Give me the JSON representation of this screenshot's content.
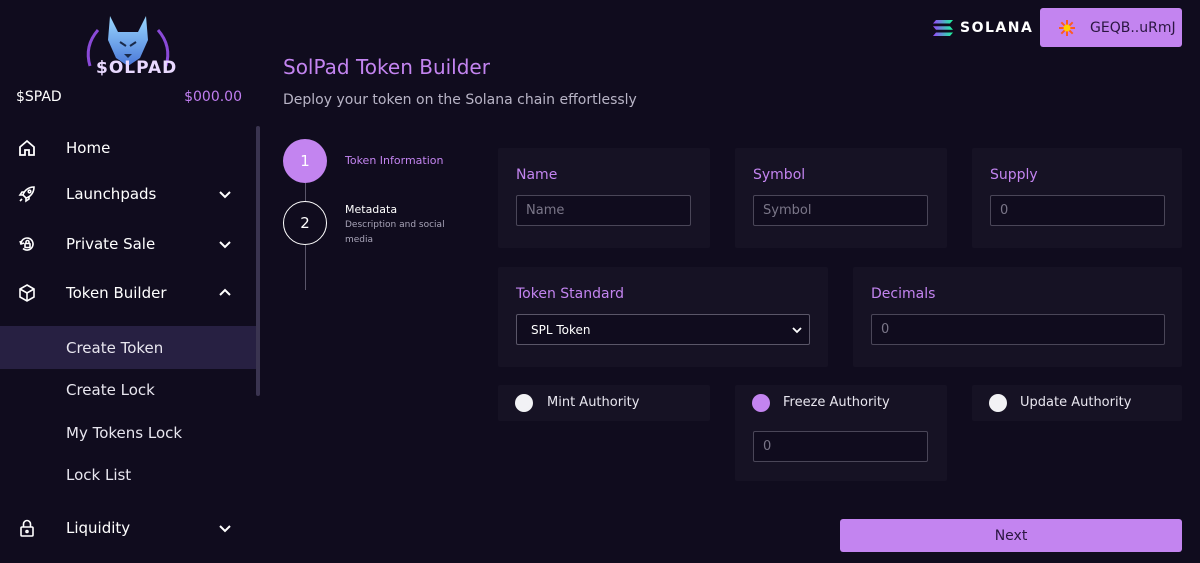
{
  "brand": {
    "logo_text": "$OLPAD"
  },
  "balance": {
    "ticker": "$SPAD",
    "amount": "$000.00"
  },
  "sidebar": {
    "items": [
      {
        "label": "Home",
        "icon": "home-icon"
      },
      {
        "label": "Launchpads",
        "icon": "rocket-icon"
      },
      {
        "label": "Private Sale",
        "icon": "refresh-lock-icon"
      },
      {
        "label": "Token Builder",
        "icon": "cube-icon"
      },
      {
        "label": "Liquidity",
        "icon": "lock-icon"
      }
    ],
    "sub_items": [
      {
        "label": "Create Token",
        "active": true
      },
      {
        "label": "Create Lock",
        "active": false
      },
      {
        "label": "My Tokens Lock",
        "active": false
      },
      {
        "label": "Lock List",
        "active": false
      }
    ]
  },
  "header": {
    "network_label": "SOLANA",
    "wallet_address": "GEQB..uRmJ"
  },
  "page": {
    "title": "SolPad Token Builder",
    "subtitle": "Deploy your token on the Solana chain effortlessly"
  },
  "stepper": {
    "steps": [
      {
        "number": "1",
        "title": "Token Information",
        "description": ""
      },
      {
        "number": "2",
        "title": "Metadata",
        "description": "Description and social media"
      }
    ]
  },
  "form": {
    "name": {
      "label": "Name",
      "placeholder": "Name"
    },
    "symbol": {
      "label": "Symbol",
      "placeholder": "Symbol"
    },
    "supply": {
      "label": "Supply",
      "placeholder": "0"
    },
    "token_standard": {
      "label": "Token Standard",
      "value": "SPL Token"
    },
    "decimals": {
      "label": "Decimals",
      "placeholder": "0"
    },
    "mint_authority": {
      "label": "Mint Authority",
      "checked": false
    },
    "freeze_authority": {
      "label": "Freeze Authority",
      "checked": true,
      "placeholder": "0"
    },
    "update_authority": {
      "label": "Update Authority",
      "checked": false
    },
    "next_label": "Next"
  },
  "colors": {
    "accent": "#c384f0",
    "background": "#100c1e",
    "card": "#161224"
  }
}
